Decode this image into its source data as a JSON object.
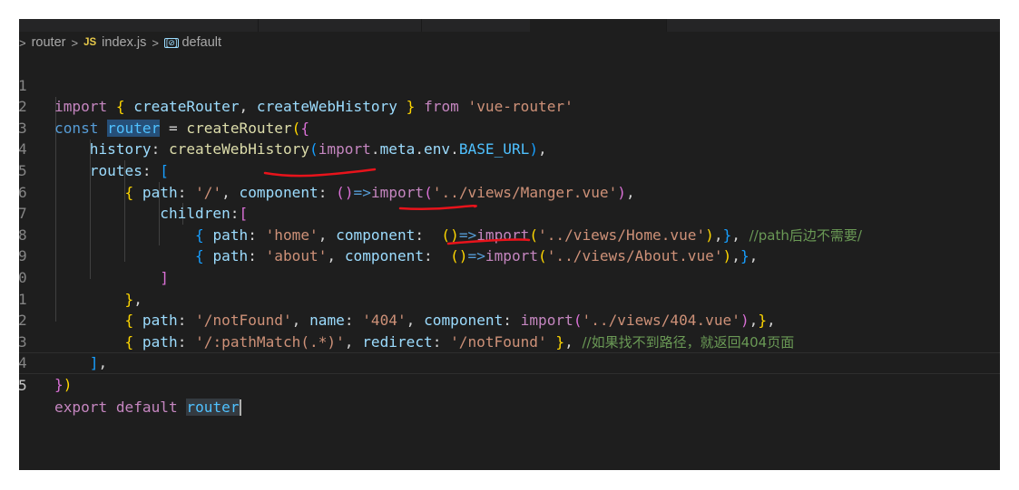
{
  "breadcrumb": {
    "folder": "router",
    "file_icon": "JS",
    "file": "index.js",
    "symbol_icon": "[⊘]",
    "symbol": "default"
  },
  "code_lines": [
    {
      "n": "1"
    },
    {
      "n": "2"
    },
    {
      "n": "3"
    },
    {
      "n": "4"
    },
    {
      "n": "5"
    },
    {
      "n": "6"
    },
    {
      "n": "7"
    },
    {
      "n": "8"
    },
    {
      "n": "9"
    },
    {
      "n": "0"
    },
    {
      "n": "1"
    },
    {
      "n": "2"
    },
    {
      "n": "3"
    },
    {
      "n": "4"
    },
    {
      "n": "5"
    }
  ],
  "tokens": {
    "import": "import",
    "createRouter": "createRouter",
    "createWebHistory": "createWebHistory",
    "from": "from",
    "vue_router": "'vue-router'",
    "const": "const",
    "router": "router",
    "history": "history",
    "import_meta": "import",
    "meta": "meta",
    "env": "env",
    "BASE_URL": "BASE_URL",
    "routes": "routes",
    "path": "path",
    "component": "component",
    "children": "children",
    "name": "name",
    "redirect": "redirect",
    "s_root": "'/'",
    "s_manger": "'../views/Manger.vue'",
    "s_home": "'home'",
    "s_home_vue": "'../views/Home.vue'",
    "s_about": "'about'",
    "s_about_vue": "'../views/About.vue'",
    "s_notfound": "'/notFound'",
    "s_404": "'404'",
    "s_404_vue": "'../views/404.vue'",
    "s_pathmatch": "'/:pathMatch(.*)'",
    "s_notfound2": "'/notFound'",
    "export": "export",
    "default": "default",
    "comment1": "//path后边不需要/",
    "comment2": "//如果找不到路径，就返回404页面"
  },
  "annotation_color": "#e8131b"
}
